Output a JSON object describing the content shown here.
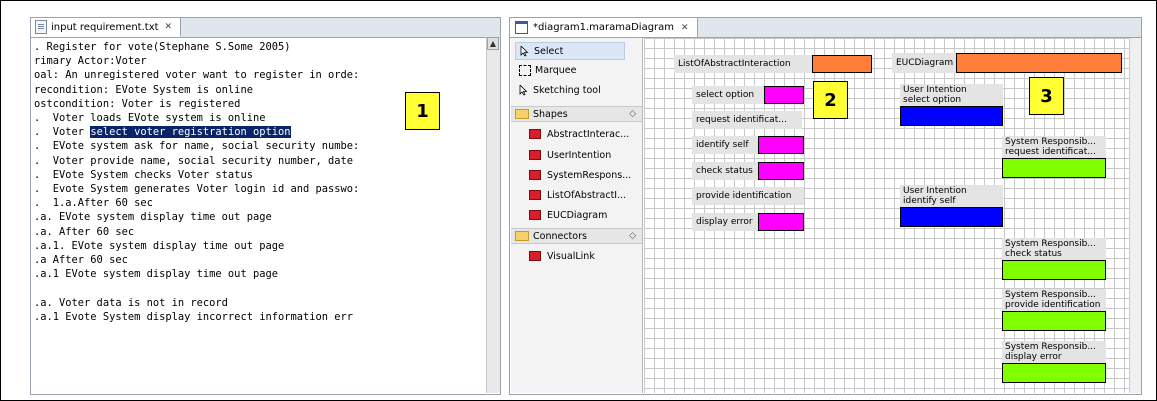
{
  "text_editor": {
    "tab_title": "input requirement.txt",
    "close_glyph": "✕",
    "lines": [
      ". Register for vote(Stephane S.Some 2005)",
      "rimary Actor:Voter",
      "oal: An unregistered voter want to register in orde:",
      "recondition: EVote System is online",
      "ostcondition: Voter is registered",
      ".  Voter loads EVote system is online",
      "|SEL|",
      ".  EVote system ask for name, social security numbe:",
      ".  Voter provide name, social security number, date",
      ".  EVote System checks Voter status",
      ".  Evote System generates Voter login id and passwo:",
      ".  1.a.After 60 sec",
      ".a. EVote system display time out page",
      ".a. After 60 sec",
      ".a.1. EVote system display time out page",
      ".a After 60 sec",
      ".a.1 EVote system display time out page",
      "",
      ".a. Voter data is not in record",
      ".a.1 Evote System display incorrect information err"
    ],
    "selected_line_prefix": ".  Voter ",
    "selected_text": "select voter registration option",
    "scroll_up_glyph": "▲"
  },
  "markers": [
    "1",
    "2",
    "3"
  ],
  "diagram_editor": {
    "tab_title": "*diagram1.maramaDiagram",
    "close_glyph": "✕",
    "palette": {
      "tools": [
        "Select",
        "Marquee",
        "Sketching tool"
      ],
      "shapes_drawer": "Shapes",
      "shapes": [
        "AbstractInterac...",
        "UserIntention",
        "SystemRespons...",
        "ListOfAbstractI...",
        "EUCDiagram"
      ],
      "connectors_drawer": "Connectors",
      "connectors": [
        "VisualLink"
      ],
      "collapse_glyph": "◇"
    },
    "canvas": {
      "list_title": "ListOfAbstractInteraction",
      "list_items": [
        "select option",
        "request identificat...",
        "identify self",
        "check status",
        "provide identification",
        "display error"
      ],
      "euc_title": "EUCDiagram",
      "user_intentions": [
        {
          "line1": "User Intention",
          "line2": "select option"
        },
        {
          "line1": "User Intention",
          "line2": "identify self"
        }
      ],
      "system_responsibilities": [
        {
          "line1": "System Responsib...",
          "line2": "request identificat..."
        },
        {
          "line1": "System Responsib...",
          "line2": "check status"
        },
        {
          "line1": "System Responsib...",
          "line2": "provide identification"
        },
        {
          "line1": "System Responsib...",
          "line2": "display error"
        }
      ]
    }
  },
  "colors": {
    "pink": "#ff00ff",
    "orange": "#ff7f3a",
    "blue": "#0000ff",
    "green": "#80ff00",
    "marker_yellow": "#ffff33",
    "selection": "#0a246a"
  }
}
